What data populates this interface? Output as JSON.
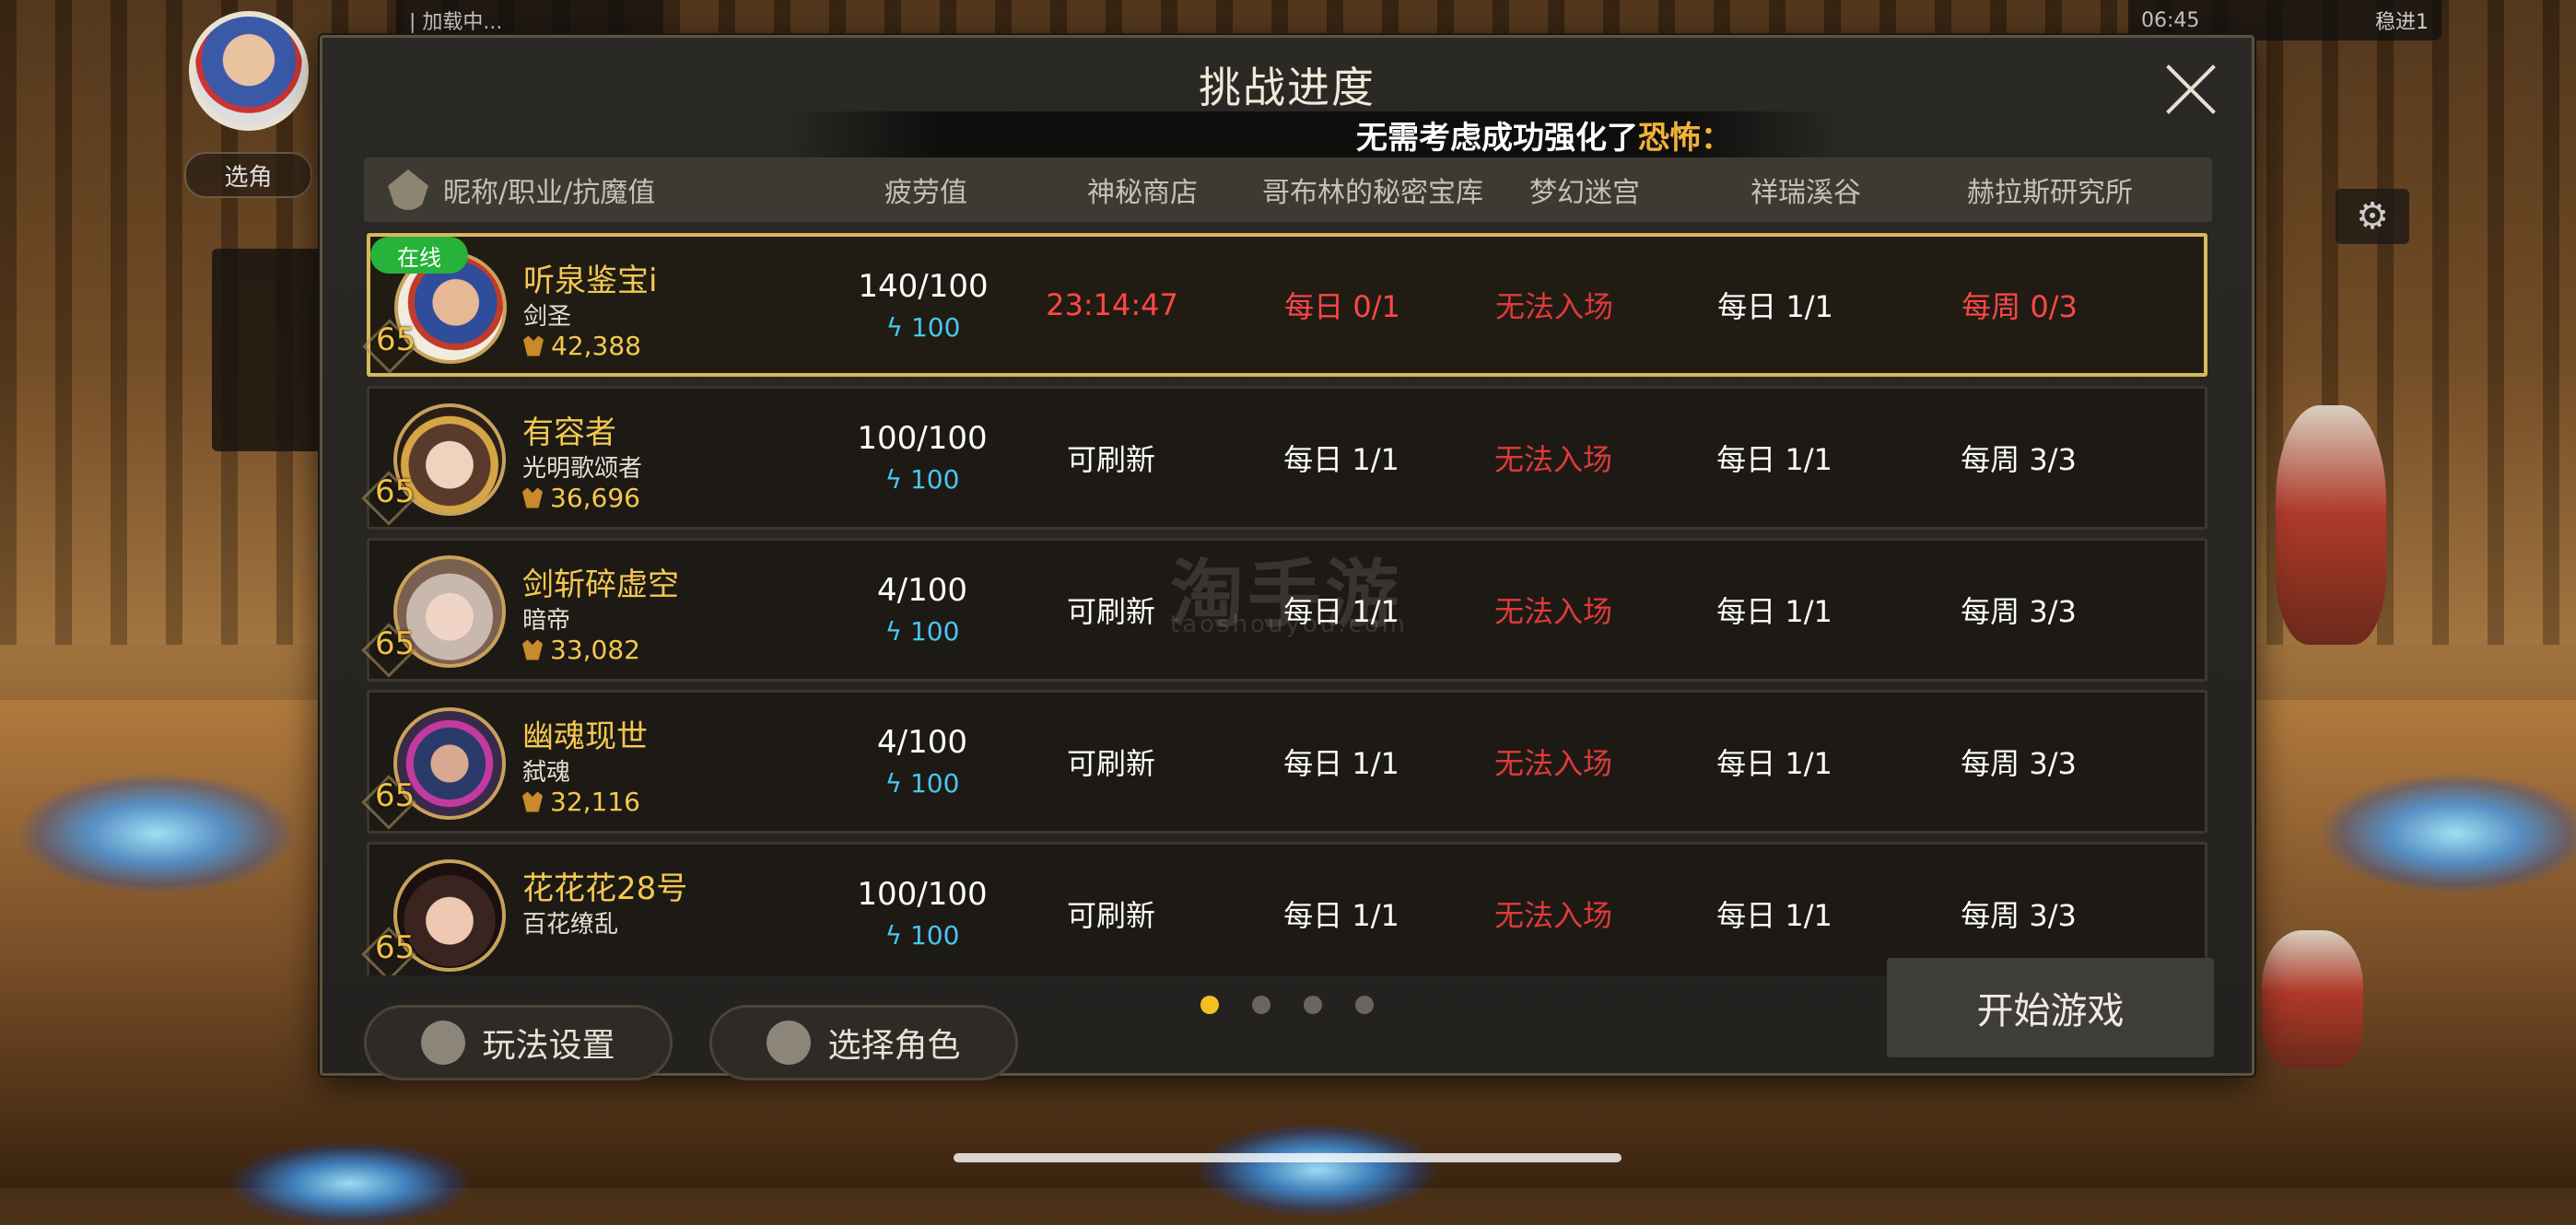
{
  "status": {
    "left_text": "| 加载中...",
    "right_time": "06:45",
    "right_extra": "稳进1"
  },
  "top_button": "选角",
  "dialog": {
    "title": "挑战进度",
    "marquee_white": "无需考虑成功强化了",
    "marquee_highlight": "恐怖：",
    "columns": [
      "昵称/职业/抗魔值",
      "疲劳值",
      "神秘商店",
      "哥布林的秘密宝库",
      "梦幻迷宫",
      "祥瑞溪谷",
      "赫拉斯研究所"
    ],
    "online_label": "在线",
    "characters": [
      {
        "name": "听泉鉴宝i",
        "job": "剑圣",
        "level": "65",
        "power": "42,388",
        "fatigue": "140/100",
        "energy": "100",
        "shop": "23:14:47",
        "goblin": "每日 0/1",
        "maze": "无法入场",
        "valley": "每日 1/1",
        "hellas": "每周 0/3",
        "online": true,
        "selected": true
      },
      {
        "name": "有容者",
        "job": "光明歌颂者",
        "level": "65",
        "power": "36,696",
        "fatigue": "100/100",
        "energy": "100",
        "shop": "可刷新",
        "goblin": "每日 1/1",
        "maze": "无法入场",
        "valley": "每日 1/1",
        "hellas": "每周 3/3"
      },
      {
        "name": "剑斩碎虚空",
        "job": "暗帝",
        "level": "65",
        "power": "33,082",
        "fatigue": "4/100",
        "energy": "100",
        "shop": "可刷新",
        "goblin": "每日 1/1",
        "maze": "无法入场",
        "valley": "每日 1/1",
        "hellas": "每周 3/3"
      },
      {
        "name": "幽魂现世",
        "job": "弑魂",
        "level": "65",
        "power": "32,116",
        "fatigue": "4/100",
        "energy": "100",
        "shop": "可刷新",
        "goblin": "每日 1/1",
        "maze": "无法入场",
        "valley": "每日 1/1",
        "hellas": "每周 3/3"
      },
      {
        "name": "花花花28号",
        "job": "百花缭乱",
        "level": "65",
        "power": "",
        "fatigue": "100/100",
        "energy": "100",
        "shop": "可刷新",
        "goblin": "每日 1/1",
        "maze": "无法入场",
        "valley": "每日 1/1",
        "hellas": "每周 3/3"
      }
    ],
    "buttons": {
      "settings": "玩法设置",
      "select_role": "选择角色",
      "start": "开始游戏"
    },
    "pagination": {
      "pages": 4,
      "current": 1
    },
    "watermark": "淘手游",
    "watermark_url": "taoshouyou.com"
  },
  "colors": {
    "accent": "#f2c021",
    "red": "#ff4747",
    "energy": "#48c6f0",
    "online": "#27b23a",
    "gold_text": "#f5c851"
  }
}
